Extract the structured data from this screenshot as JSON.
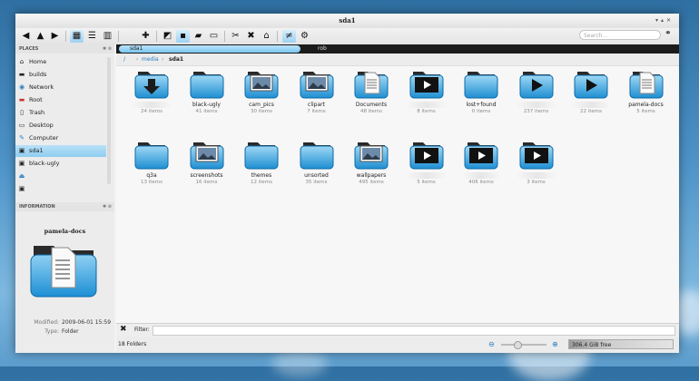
{
  "window": {
    "title": "sda1"
  },
  "search": {
    "placeholder": "Search..."
  },
  "toolbar": {
    "icons": [
      "back-icon",
      "up-icon",
      "forward-icon",
      "icon-view-icon",
      "details-view-icon",
      "columns-view-icon",
      "new-tab-icon",
      "preview-icon",
      "terminal-icon",
      "open-folder-icon",
      "split-view-icon",
      "cut-icon",
      "delete-icon",
      "trash-icon",
      "filter-icon",
      "settings-icon"
    ]
  },
  "sidebar": {
    "places_header": "PLACES",
    "places": [
      "Home",
      "builds",
      "Network",
      "Root",
      "Trash",
      "Desktop",
      "Computer",
      "sda1",
      "black-ugly"
    ],
    "info_header": "INFORMATION",
    "info_title": "pamela-docs",
    "modified_key": "Modified:",
    "modified_val": "2009-06-01 15:59",
    "type_key": "Type:",
    "type_val": "Folder"
  },
  "pathbar": {
    "active": "sda1",
    "second": "rob"
  },
  "crumbs": {
    "root": "/",
    "media": "media",
    "current": "sda1"
  },
  "files": [
    {
      "name": "",
      "count": "24 items",
      "icon": "download"
    },
    {
      "name": "black-ugly",
      "count": "41 items",
      "icon": "folder"
    },
    {
      "name": "cam_pics",
      "count": "30 items",
      "icon": "image"
    },
    {
      "name": "clipart",
      "count": "7 items",
      "icon": "image"
    },
    {
      "name": "Documents",
      "count": "48 items",
      "icon": "docs"
    },
    {
      "name": "",
      "count": "8 items",
      "icon": "video"
    },
    {
      "name": "lost+found",
      "count": "0 items",
      "icon": "folder"
    },
    {
      "name": "",
      "count": "237 items",
      "icon": "play"
    },
    {
      "name": "",
      "count": "22 items",
      "icon": "play"
    },
    {
      "name": "pamela-docs",
      "count": "5 items",
      "icon": "docs"
    },
    {
      "name": "q3a",
      "count": "13 items",
      "icon": "folder"
    },
    {
      "name": "screenshots",
      "count": "16 items",
      "icon": "image"
    },
    {
      "name": "themes",
      "count": "12 items",
      "icon": "folder"
    },
    {
      "name": "unsorted",
      "count": "35 items",
      "icon": "folder"
    },
    {
      "name": "wallpapers",
      "count": "495 items",
      "icon": "image"
    },
    {
      "name": "",
      "count": "5 items",
      "icon": "video"
    },
    {
      "name": "",
      "count": "406 items",
      "icon": "video"
    },
    {
      "name": "",
      "count": "3 items",
      "icon": "video"
    }
  ],
  "filter": {
    "label": "Filter:"
  },
  "status": {
    "folders": "18 Folders",
    "free": "306.4 GiB free"
  }
}
